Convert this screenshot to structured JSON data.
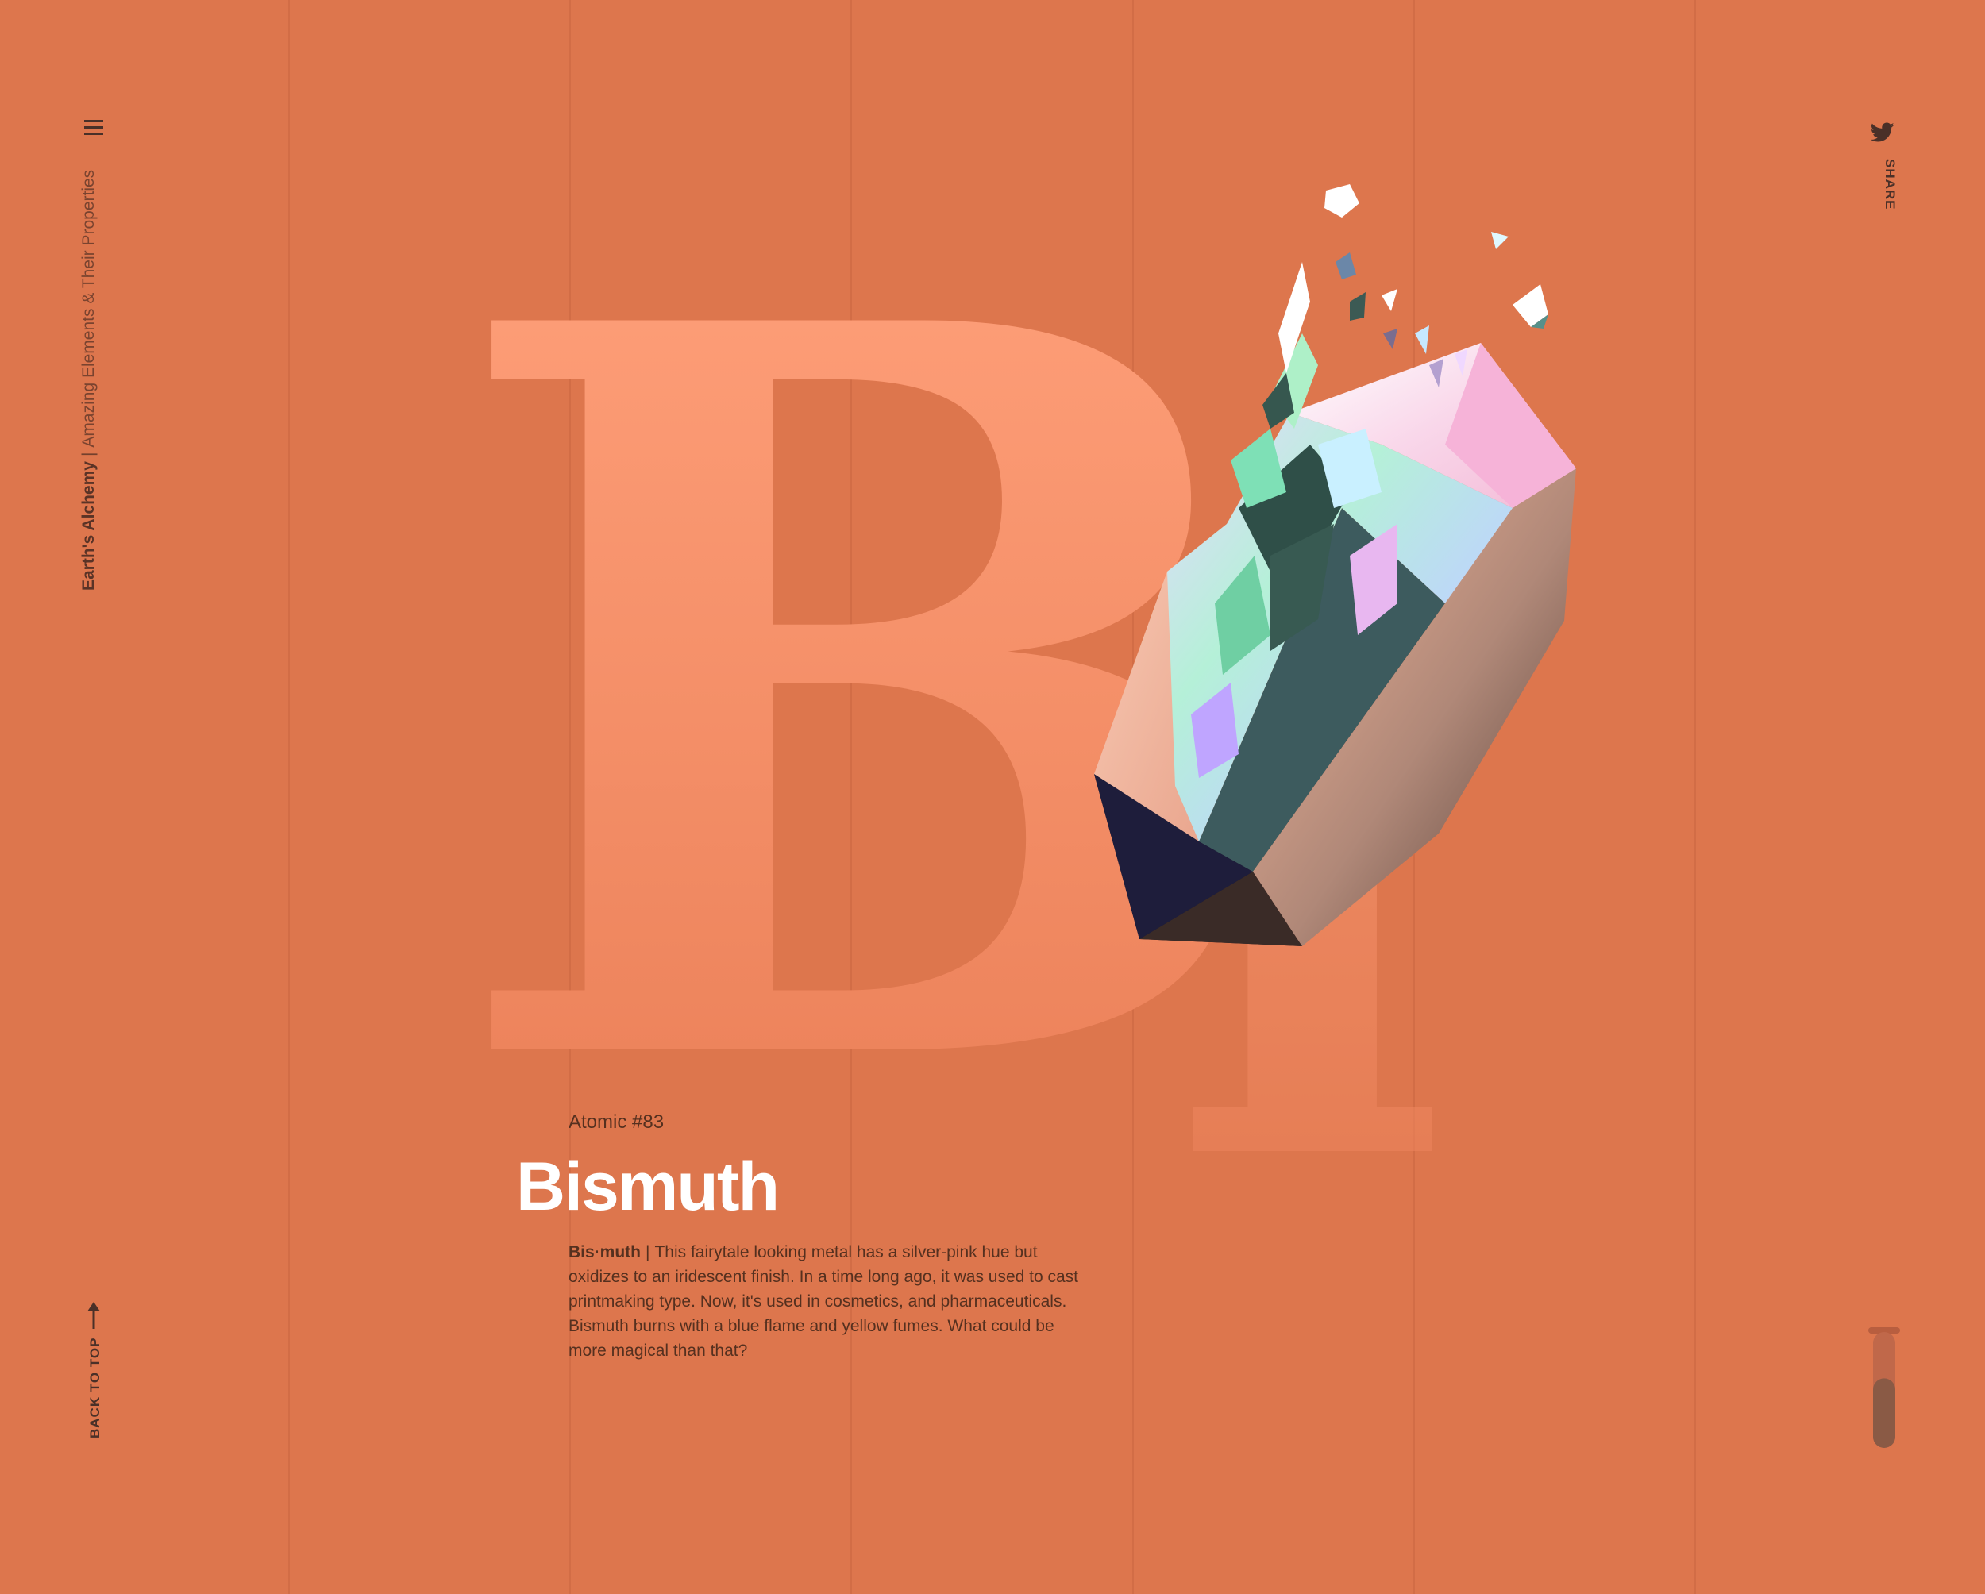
{
  "colors": {
    "background": "#dd764d",
    "letter_light": "#ffa07a",
    "text_dark": "#55301f",
    "title": "#ffffff",
    "icon": "#4a3028"
  },
  "nav": {
    "menu_icon": "hamburger-menu-icon",
    "brand": "Earth's Alchemy",
    "separator": "|",
    "tagline": "Amazing Elements & Their Properties"
  },
  "share": {
    "icon": "twitter-bird-icon",
    "label": "SHARE"
  },
  "back_to_top": {
    "icon": "arrow-up-icon",
    "label": "BACK TO TOP"
  },
  "background_symbol": {
    "first_letter": "B",
    "second_letter": "i"
  },
  "element": {
    "atomic_label": "Atomic #83",
    "name": "Bismuth",
    "pronunciation": "Bis·muth",
    "separator": "|",
    "description": "This fairytale looking metal has a silver-pink hue but oxidizes to an iridescent finish. In a time long ago, it was used to cast printmaking type. Now, it's used in cosmetics, and pharmaceuticals. Bismuth burns with a blue flame and yellow fumes. What could be more magical than that?"
  },
  "progress_tube": {
    "icon": "test-tube-icon",
    "fill_fraction": 0.6
  }
}
